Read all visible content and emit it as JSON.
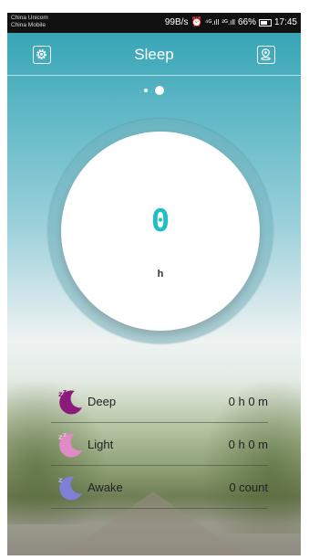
{
  "status_bar": {
    "carrier_1": "China Unicom",
    "carrier_2": "China Mobile",
    "net_speed": "99B/s",
    "signal_1": "⁴ᴳ.ıll",
    "signal_2": "²ᴳ.ıll",
    "battery_percent": "66%",
    "time": "17:45"
  },
  "header": {
    "title": "Sleep"
  },
  "pager": {
    "page_count": 2,
    "current_page": 2
  },
  "summary": {
    "value": "0",
    "unit": "h"
  },
  "rows": [
    {
      "label": "Deep",
      "value": "0 h 0 m",
      "icon": "moon-deep-icon",
      "color": "#8b1a7a"
    },
    {
      "label": "Light",
      "value": "0 h 0 m",
      "icon": "moon-light-icon",
      "color": "#e08bc8"
    },
    {
      "label": "Awake",
      "value": "0 count",
      "icon": "moon-awake-icon",
      "color": "#7f7fd6"
    }
  ],
  "colors": {
    "accent": "#1fbfc6",
    "header_bg": "#2ea0b2"
  }
}
